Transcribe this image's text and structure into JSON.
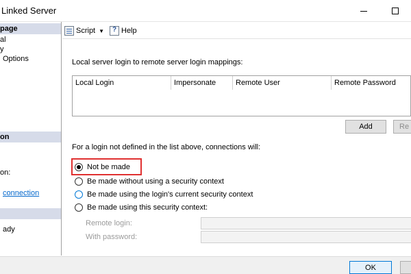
{
  "window": {
    "title": "Linked Server"
  },
  "left_pane": {
    "header_page": "page",
    "items": [
      "al",
      "y",
      "Options"
    ],
    "header_connection": "on",
    "connection_label": "on:",
    "connection_link": "connection",
    "header_progress": "",
    "progress_status": "ady"
  },
  "toolbar": {
    "script_label": "Script",
    "help_label": "Help"
  },
  "mappings": {
    "section_label": "Local server login to remote server login mappings:",
    "columns": [
      "Local Login",
      "Impersonate",
      "Remote User",
      "Remote Password"
    ],
    "add_label": "Add",
    "remove_label": "Re"
  },
  "connections": {
    "section_label": "For a login not defined in the list above, connections will:",
    "options": [
      {
        "label": "Not be made",
        "checked": true
      },
      {
        "label": "Be made without using a security context",
        "checked": false
      },
      {
        "label": "Be made using the login's current security context",
        "checked": false
      },
      {
        "label": "Be made using this security context:",
        "checked": false
      }
    ],
    "remote_login_label": "Remote login:",
    "with_password_label": "With password:"
  },
  "buttons": {
    "ok_label": "OK"
  },
  "colors": {
    "highlight": "#e03030",
    "link": "#0066cc",
    "header_bg": "#d6dbe9",
    "accent": "#0078d7"
  }
}
